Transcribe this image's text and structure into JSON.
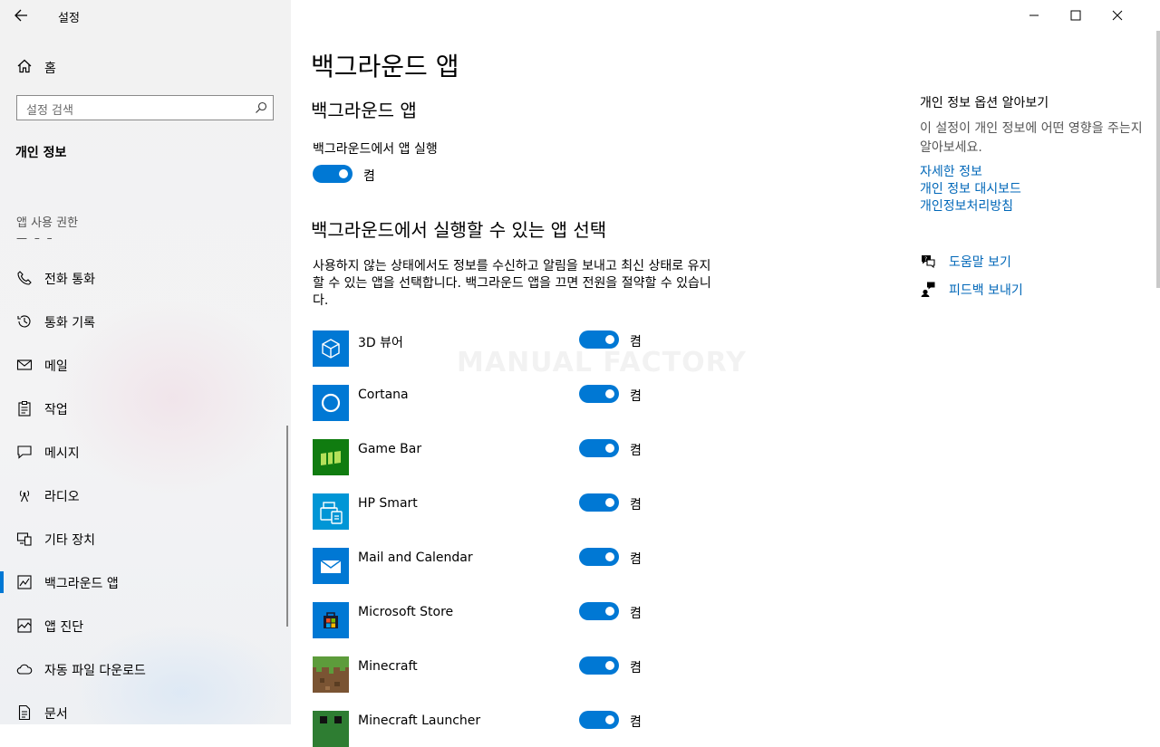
{
  "window": {
    "title": "설정"
  },
  "sidebar": {
    "home_label": "홈",
    "search_placeholder": "설정 검색",
    "section_title": "개인 정보",
    "group_title": "앱 사용 권한",
    "dashes": "— – –",
    "items": [
      {
        "label": "전화 통화",
        "icon": "phone-icon"
      },
      {
        "label": "통화 기록",
        "icon": "history-icon"
      },
      {
        "label": "메일",
        "icon": "mail-icon"
      },
      {
        "label": "작업",
        "icon": "tasks-icon"
      },
      {
        "label": "메시지",
        "icon": "message-icon"
      },
      {
        "label": "라디오",
        "icon": "radio-icon"
      },
      {
        "label": "기타 장치",
        "icon": "devices-icon"
      },
      {
        "label": "백그라운드 앱",
        "icon": "background-apps-icon",
        "selected": true
      },
      {
        "label": "앱 진단",
        "icon": "diagnostics-icon"
      },
      {
        "label": "자동 파일 다운로드",
        "icon": "cloud-icon"
      },
      {
        "label": "문서",
        "icon": "document-icon"
      }
    ]
  },
  "main": {
    "page_title": "백그라운드 앱",
    "section1_title": "백그라운드 앱",
    "run_label": "백그라운드에서 앱 실행",
    "run_toggle": {
      "state": "on",
      "text": "켬"
    },
    "section2_title": "백그라운드에서 실행할 수 있는 앱 선택",
    "description": "사용하지 않는 상태에서도 정보를 수신하고 알림을 보내고 최신 상태로 유지할 수 있는 앱을 선택합니다. 백그라운드 앱을 끄면 전원을 절약할 수 있습니다.",
    "watermark": "MANUAL FACTORY",
    "apps": [
      {
        "name": "3D 뷰어",
        "toggle": "켬",
        "icon": "cube-icon"
      },
      {
        "name": "Cortana",
        "toggle": "켬",
        "icon": "cortana-icon"
      },
      {
        "name": "Game Bar",
        "toggle": "켬",
        "icon": "gamebar-icon"
      },
      {
        "name": "HP Smart",
        "toggle": "켬",
        "icon": "printer-icon"
      },
      {
        "name": "Mail and Calendar",
        "toggle": "켬",
        "icon": "mail-calendar-icon"
      },
      {
        "name": "Microsoft Store",
        "toggle": "켬",
        "icon": "store-icon"
      },
      {
        "name": "Minecraft",
        "toggle": "켬",
        "icon": "minecraft-icon"
      },
      {
        "name": "Minecraft Launcher",
        "toggle": "켬",
        "icon": "minecraft-launcher-icon"
      }
    ]
  },
  "right": {
    "heading": "개인 정보 옵션 알아보기",
    "text": "이 설정이 개인 정보에 어떤 영향을 주는지 알아보세요.",
    "links": [
      "자세한 정보",
      "개인 정보 대시보드",
      "개인정보처리방침"
    ],
    "help": "도움말 보기",
    "feedback": "피드백 보내기"
  },
  "colors": {
    "accent": "#0078d4",
    "link": "#0067b8"
  }
}
